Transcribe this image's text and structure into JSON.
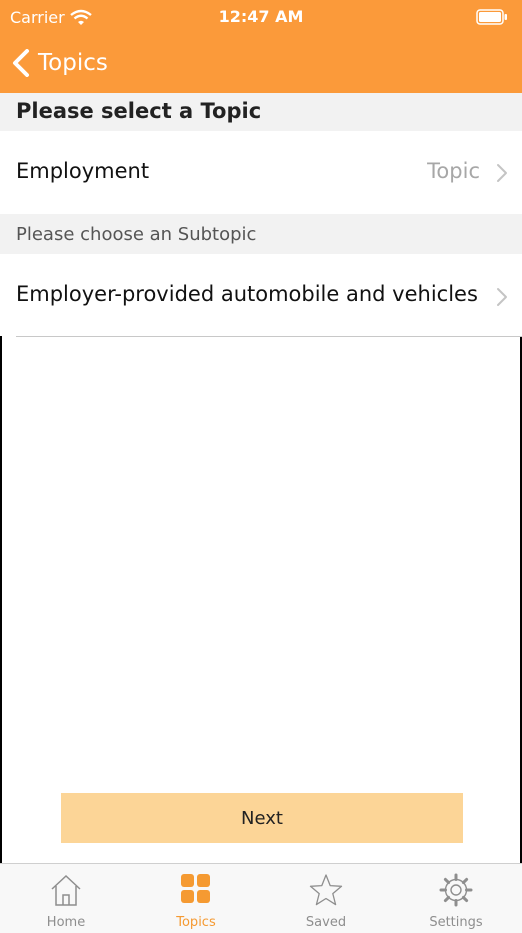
{
  "status_bar": {
    "carrier": "Carrier",
    "time": "12:47 AM"
  },
  "nav": {
    "back_label": "Topics",
    "back_icon": "chevron-left-icon"
  },
  "topic_section": {
    "title": "Please select a Topic",
    "row_label": "Employment",
    "row_value": "Topic"
  },
  "subtopic_section": {
    "header": "Please choose an Subtopic",
    "row_label": "Employer-provided automobile and vehicles"
  },
  "next_button": {
    "label": "Next"
  },
  "tabbar": {
    "tabs": [
      {
        "label": "Home",
        "icon": "home-icon",
        "active": false
      },
      {
        "label": "Topics",
        "icon": "grid-icon",
        "active": true
      },
      {
        "label": "Saved",
        "icon": "star-icon",
        "active": false
      },
      {
        "label": "Settings",
        "icon": "gear-icon",
        "active": false
      }
    ]
  },
  "colors": {
    "accent": "#fb9a3a",
    "button": "#fcd597",
    "active_tab": "#f59a32"
  }
}
